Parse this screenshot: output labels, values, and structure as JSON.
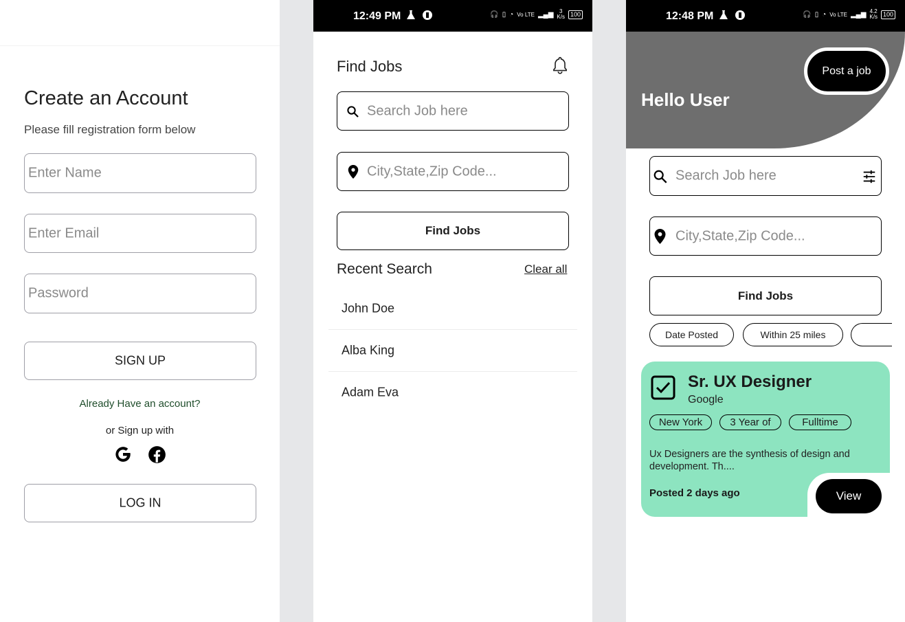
{
  "screen1": {
    "title": "Create an Account",
    "subtitle": "Please fill registration form below",
    "name_placeholder": "Enter Name",
    "email_placeholder": "Enter Email",
    "password_placeholder": "Password",
    "signup_label": "SIGN UP",
    "already_account": "Already Have an account?",
    "or_signup_with": "or Sign up with",
    "login_label": "LOG IN",
    "colors": {
      "link": "#1f4d2b"
    }
  },
  "screen2": {
    "status": {
      "time": "12:49 PM",
      "speed": "3",
      "speed_unit": "K/s",
      "battery": "100",
      "network": "Vo LTE"
    },
    "title": "Find Jobs",
    "search_placeholder": "Search Job here",
    "location_placeholder": "City,State,Zip Code...",
    "find_label": "Find Jobs",
    "recent_title": "Recent Search",
    "clear_all": "Clear all",
    "recent_items": [
      "John Doe",
      "Alba King",
      "Adam Eva"
    ]
  },
  "screen3": {
    "status": {
      "time": "12:48 PM",
      "speed": "4.2",
      "speed_unit": "K/s",
      "battery": "100",
      "network": "Vo LTE"
    },
    "greeting": "Hello User",
    "post_job_label": "Post a job",
    "search_placeholder": "Search Job here",
    "location_placeholder": "City,State,Zip Code...",
    "find_label": "Find Jobs",
    "filter_chips": [
      "Date Posted",
      "Within 25 miles",
      ""
    ],
    "job": {
      "title": "Sr. UX Designer",
      "company": "Google",
      "tags": [
        "New York",
        "3 Year of",
        "Fulltime"
      ],
      "description": "Ux Designers are the synthesis of design and development. Th....",
      "posted": "Posted 2 days ago",
      "view_label": "View"
    },
    "colors": {
      "header": "#6e6e6e",
      "card": "#8de4c0"
    }
  },
  "icons": {
    "search": "search-icon",
    "location": "location-pin-icon",
    "bell": "bell-icon",
    "filter": "filter-sliders-icon",
    "check": "checkbox-checked-icon",
    "google": "google-icon",
    "facebook": "facebook-icon"
  }
}
